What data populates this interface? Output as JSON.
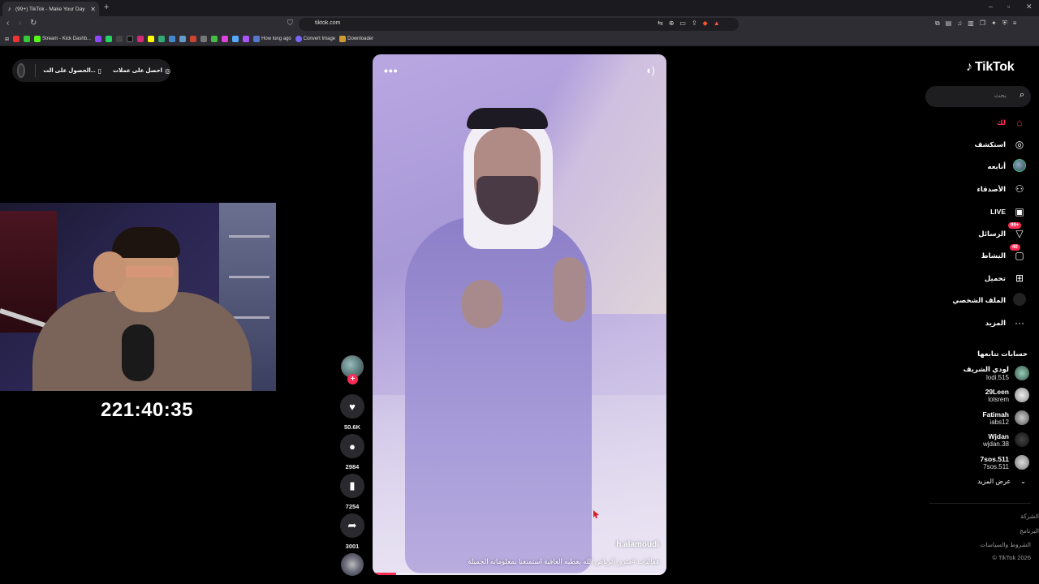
{
  "browser": {
    "tab_title": "(99+) TikTok - Make Your Day",
    "url": "tiktok.com",
    "bookmarks": [
      "Stream - Kick Dashb...",
      "How long ago",
      "Convert Image",
      "Downloader"
    ]
  },
  "coins_bar": {
    "get_coins": "احصل على عملات",
    "get_app": "الحصول على الت..."
  },
  "stream": {
    "timer": "221:40:35"
  },
  "video": {
    "username": "h.alamoudi",
    "caption": "فعاليات #مترو_الرياض الله يعطيه العافية استمتعنا بمعلوماته الجميلة",
    "progress": 0.08
  },
  "actions": {
    "likes": "50.6K",
    "comments": "2984",
    "saves": "7254",
    "shares": "3001"
  },
  "sidebar": {
    "logo_text": "TikTok",
    "search_placeholder": "بحث",
    "nav": [
      {
        "label": "لك",
        "icon": "home-icon",
        "active": true
      },
      {
        "label": "استكشف",
        "icon": "compass-icon"
      },
      {
        "label": "أتابعه",
        "icon": "following-icon"
      },
      {
        "label": "الأصدقاء",
        "icon": "friends-icon"
      },
      {
        "label": "LIVE",
        "icon": "live-icon"
      },
      {
        "label": "الرسائل",
        "icon": "messages-icon",
        "badge": "99+"
      },
      {
        "label": "النشاط",
        "icon": "activity-icon",
        "badge": "40"
      },
      {
        "label": "تحميل",
        "icon": "upload-icon"
      },
      {
        "label": "الملف الشخصي",
        "icon": "profile-icon"
      },
      {
        "label": "المزيد",
        "icon": "more-icon"
      }
    ],
    "following_title": "حسابات تتابعها",
    "accounts": [
      {
        "name": "لودي الشريف",
        "handle": "lodi.515"
      },
      {
        "name": "29Leen",
        "handle": "lolsrem"
      },
      {
        "name": "Fatimah",
        "handle": "iabs12"
      },
      {
        "name": "Wjdan",
        "handle": "wjdan.38"
      },
      {
        "name": "7sos.511",
        "handle": "7sos.511"
      }
    ],
    "see_more": "عرض المزيد",
    "footer": [
      "الشركة",
      "البرنامج",
      "الشروط والسياسات",
      "© TikTok 2026"
    ]
  },
  "colors": {
    "accent": "#fe2c55",
    "background": "#000000"
  }
}
